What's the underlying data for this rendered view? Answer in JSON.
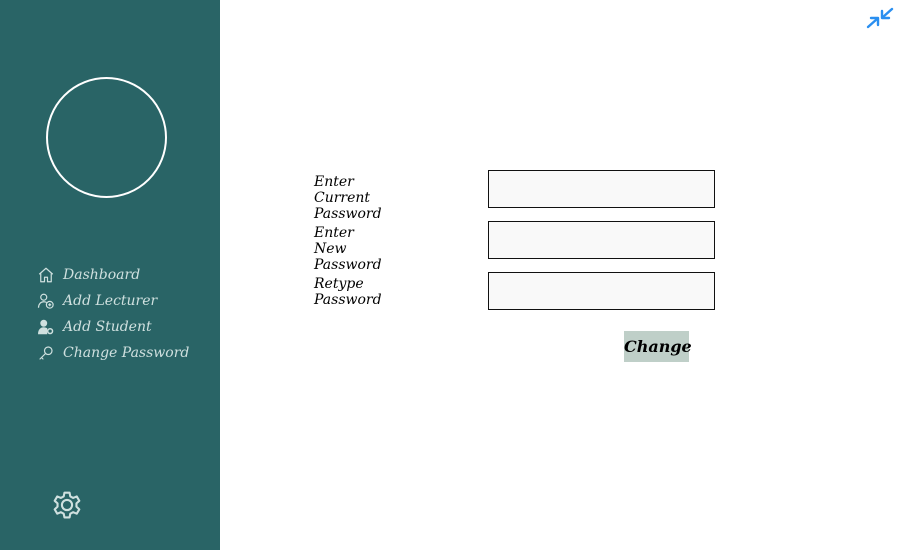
{
  "sidebar": {
    "avatar": "profile-avatar",
    "items": [
      {
        "label": "Dashboard",
        "icon": "home-icon"
      },
      {
        "label": "Add Lecturer",
        "icon": "add-user-icon"
      },
      {
        "label": "Add Student",
        "icon": "user-settings-icon"
      },
      {
        "label": "Change Password",
        "icon": "key-icon"
      }
    ],
    "settings_icon": "gear-icon"
  },
  "header": {
    "collapse_icon": "collapse-arrows-icon"
  },
  "form": {
    "fields": [
      {
        "label": "Enter Current Password",
        "value": "",
        "placeholder": ""
      },
      {
        "label": "Enter New Password",
        "value": "",
        "placeholder": ""
      },
      {
        "label": "Retype Password",
        "value": "",
        "placeholder": ""
      }
    ],
    "submit_label": "Change"
  },
  "colors": {
    "sidebar_bg": "#296466",
    "sidebar_text": "#cfe0df",
    "button_bg": "#bfcfc8",
    "accent_icon": "#2a8ff0"
  }
}
